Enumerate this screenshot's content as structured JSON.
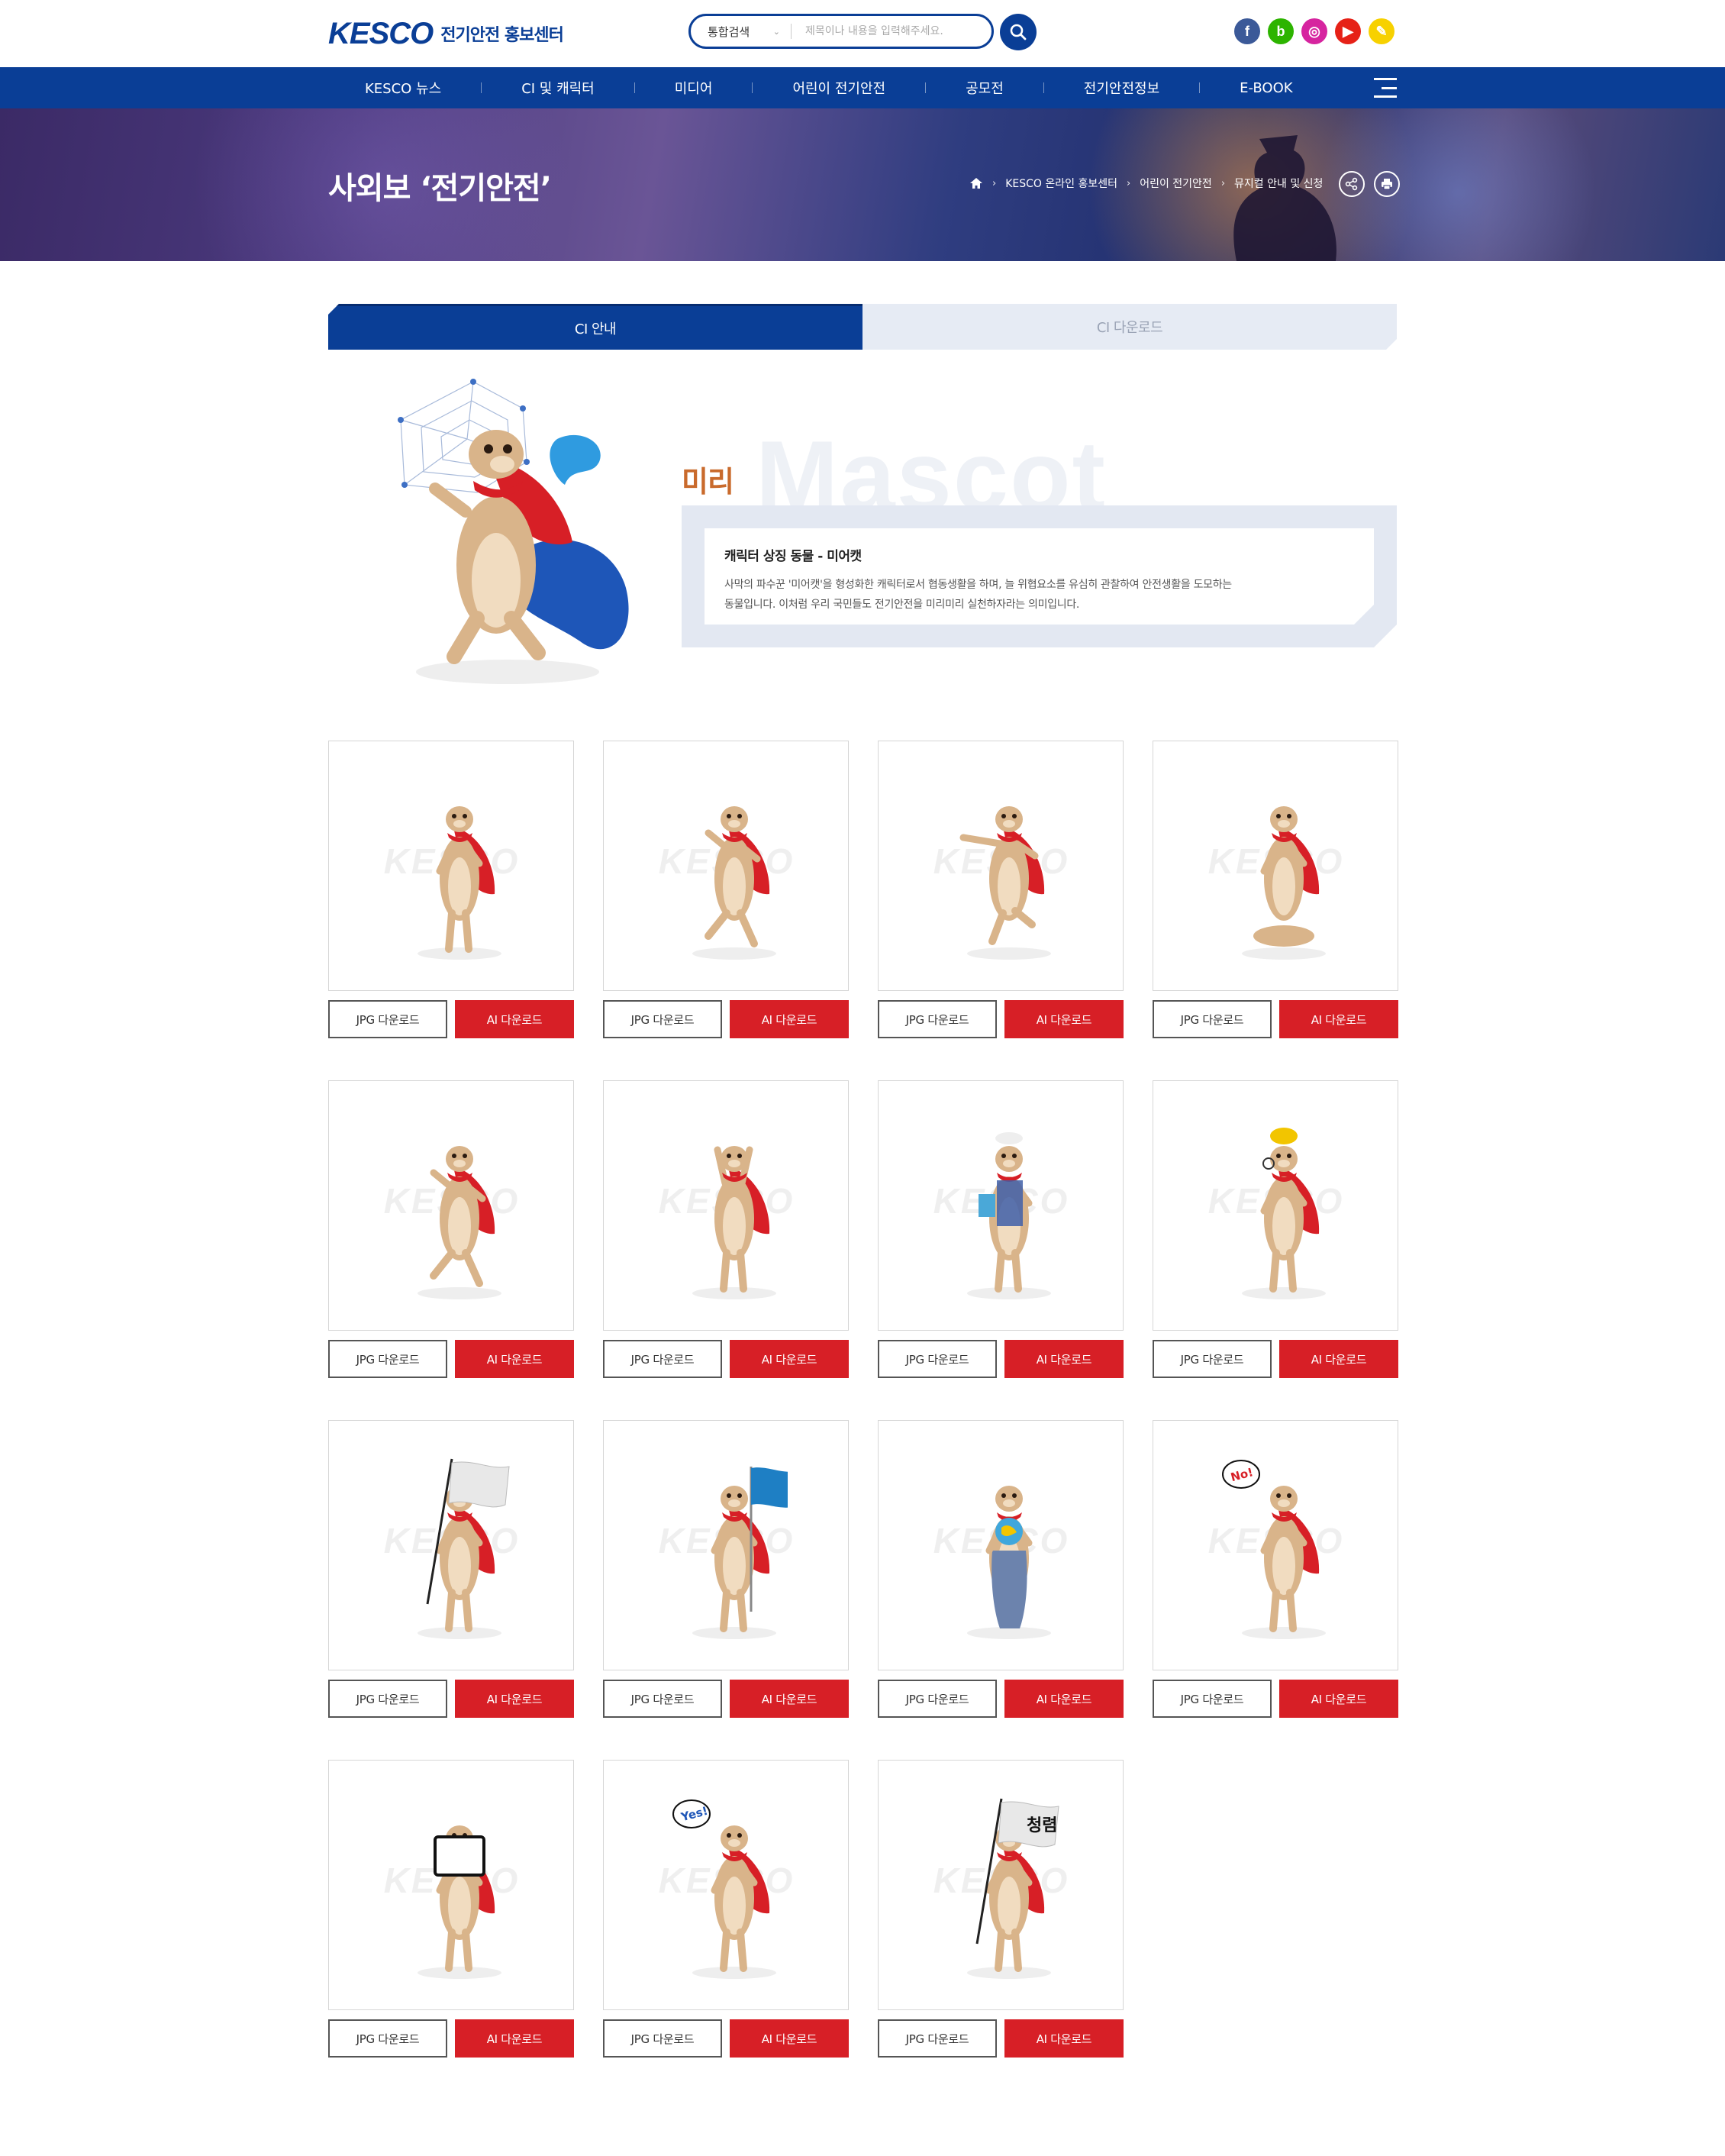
{
  "header": {
    "logo_mark": "KESCO",
    "logo_text": "전기안전 홍보센터",
    "search": {
      "category": "통합검색",
      "placeholder": "제목이나 내용을 입력해주세요."
    },
    "sns": [
      {
        "icon": "facebook-icon",
        "glyph": "f",
        "color": "#3b5998"
      },
      {
        "icon": "blog-icon",
        "glyph": "b",
        "color": "#2db400"
      },
      {
        "icon": "instagram-icon",
        "glyph": "◎",
        "color": "#d6249f"
      },
      {
        "icon": "youtube-icon",
        "glyph": "▶",
        "color": "#e62117"
      },
      {
        "icon": "kakao-icon",
        "glyph": "✎",
        "color": "#f7d100"
      }
    ]
  },
  "gnb": {
    "items": [
      "KESCO 뉴스",
      "CI 및 캐릭터",
      "미디어",
      "어린이 전기안전",
      "공모전",
      "전기안전정보",
      "E-BOOK"
    ]
  },
  "visual": {
    "title": "사외보 ‘전기안전’",
    "breadcrumb": [
      "KESCO 온라인 홍보센터",
      "어린이 전기안전",
      "뮤지컬 안내 및 신청"
    ]
  },
  "tabs": [
    {
      "label": "CI 안내",
      "active": true
    },
    {
      "label": "CI 다운로드",
      "active": false
    }
  ],
  "mascot": {
    "name": "미리",
    "bg_word": "Mascot",
    "heading": "캐릭터 상징 동물 - 미어캣",
    "desc_lines": [
      "사막의 파수꾼 '미어캣'을 형성화한 캐릭터로서 협동생활을 하며, 늘 위협요소를 유심히 관찰하여 안전생활을 도모하는",
      "동물입니다. 이처럼 우리 국민들도 전기안전을 미리미리 실천하자라는 의미입니다."
    ]
  },
  "downloads": {
    "watermark": "KESCO",
    "jpg_label": "JPG 다운로드",
    "ai_label": "AI 다운로드",
    "items": [
      {
        "pose": "standing"
      },
      {
        "pose": "walking"
      },
      {
        "pose": "flying"
      },
      {
        "pose": "sitting"
      },
      {
        "pose": "jumping"
      },
      {
        "pose": "cheering"
      },
      {
        "pose": "doctor"
      },
      {
        "pose": "inspector"
      },
      {
        "pose": "white-flag"
      },
      {
        "pose": "blue-flag"
      },
      {
        "pose": "globe"
      },
      {
        "pose": "no-sign"
      },
      {
        "pose": "board"
      },
      {
        "pose": "yes-sign"
      },
      {
        "pose": "clean-flag"
      }
    ],
    "no_bubble": "No!",
    "yes_bubble": "Yes!",
    "clean_flag_text": "청렴"
  },
  "colors": {
    "primary": "#0a3e96",
    "accent": "#d71f26",
    "mascot_body": "#d9b48a",
    "cape": "#d71f26"
  }
}
